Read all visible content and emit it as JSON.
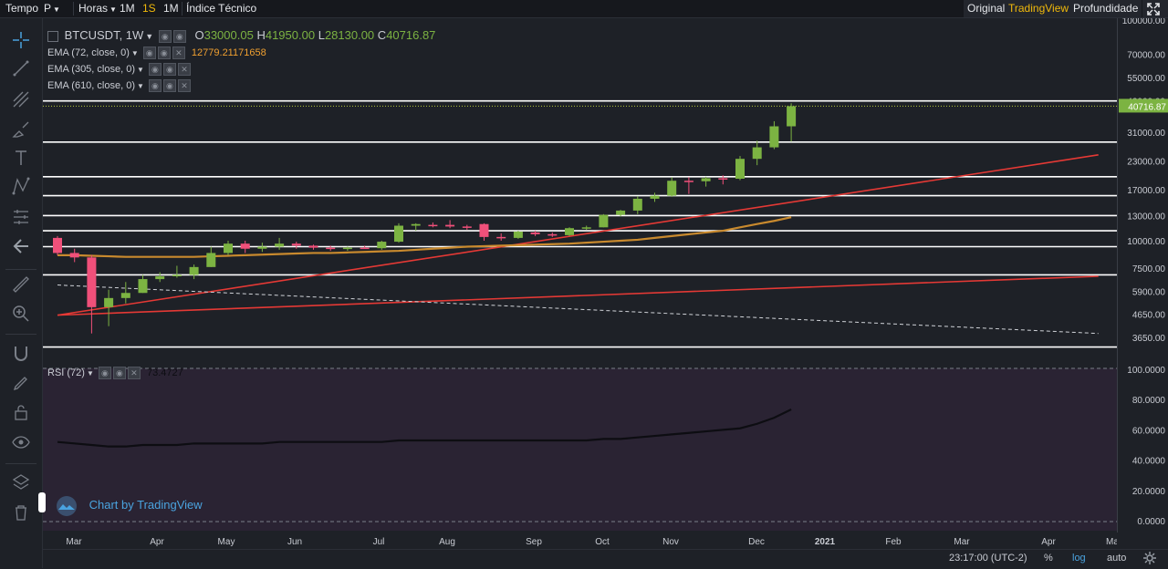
{
  "topbar": {
    "tempo": "Tempo",
    "p": "P",
    "horas": "Horas",
    "i1m_a": "1M",
    "i1s": "1S",
    "i1m_b": "1M",
    "indice": "Índice Técnico",
    "original": "Original",
    "tradingview": "TradingView",
    "profundidade": "Profundidade"
  },
  "legend": {
    "symbol": "BTCUSDT, 1W",
    "o_label": "O",
    "o_value": "33000.05",
    "h_label": "H",
    "h_value": "41950.00",
    "l_label": "L",
    "l_value": "28130.00",
    "c_label": "C",
    "c_value": "40716.87",
    "ema72": "EMA (72, close, 0)",
    "ema72_value": "12779.21171658",
    "ema305": "EMA (305, close, 0)",
    "ema610": "EMA (610, close, 0)",
    "rsi": "RSI (72)",
    "rsi_value": "73.4727"
  },
  "colors": {
    "up": "#7cb342",
    "down": "#f0507a",
    "ema": "#c98a2e",
    "trend": "#e53935",
    "accent": "#f0b90b",
    "rsi_bg": "#2a2333",
    "rsi_line": "#0d0d12"
  },
  "price_axis": {
    "labels": [
      "100000.00",
      "70000.00",
      "55000.00",
      "43000.00",
      "31000.00",
      "23000.00",
      "17000.00",
      "13000.00",
      "10000.00",
      "7500.00",
      "5900.00",
      "4650.00",
      "3650.00"
    ],
    "current": "40716.87"
  },
  "rsi_axis": {
    "labels": [
      "100.0000",
      "80.0000",
      "60.0000",
      "40.0000",
      "20.0000",
      "0.0000"
    ]
  },
  "time_axis": {
    "labels": [
      "Mar",
      "Apr",
      "May",
      "Jun",
      "Jul",
      "Aug",
      "Sep",
      "Oct",
      "Nov",
      "Dec",
      "2021",
      "Feb",
      "Mar",
      "Apr",
      "Ma"
    ]
  },
  "bottombar": {
    "time": "23:17:00 (UTC-2)",
    "percent": "%",
    "log": "log",
    "auto": "auto"
  },
  "badge": {
    "text": "Chart by TradingView"
  },
  "chart_data": {
    "type": "candlestick",
    "symbol": "BTCUSDT",
    "interval": "1W",
    "scale": "log",
    "candles": [
      {
        "o": 10300,
        "h": 10500,
        "l": 8600,
        "c": 8800
      },
      {
        "o": 8800,
        "h": 9200,
        "l": 8000,
        "c": 8400
      },
      {
        "o": 8400,
        "h": 8600,
        "l": 3800,
        "c": 5000
      },
      {
        "o": 5000,
        "h": 6000,
        "l": 4100,
        "c": 5500
      },
      {
        "o": 5500,
        "h": 6500,
        "l": 5200,
        "c": 5800
      },
      {
        "o": 5800,
        "h": 7000,
        "l": 5800,
        "c": 6700
      },
      {
        "o": 6700,
        "h": 7200,
        "l": 6500,
        "c": 6900
      },
      {
        "o": 6900,
        "h": 7700,
        "l": 6800,
        "c": 7000
      },
      {
        "o": 7000,
        "h": 7800,
        "l": 6700,
        "c": 7600
      },
      {
        "o": 7600,
        "h": 9400,
        "l": 7600,
        "c": 8800
      },
      {
        "o": 8800,
        "h": 10000,
        "l": 8600,
        "c": 9700
      },
      {
        "o": 9700,
        "h": 10000,
        "l": 8800,
        "c": 9200
      },
      {
        "o": 9200,
        "h": 9800,
        "l": 8900,
        "c": 9400
      },
      {
        "o": 9400,
        "h": 10300,
        "l": 9100,
        "c": 9700
      },
      {
        "o": 9700,
        "h": 9900,
        "l": 9200,
        "c": 9500
      },
      {
        "o": 9500,
        "h": 9600,
        "l": 9100,
        "c": 9300
      },
      {
        "o": 9300,
        "h": 9500,
        "l": 9000,
        "c": 9200
      },
      {
        "o": 9200,
        "h": 9400,
        "l": 9000,
        "c": 9300
      },
      {
        "o": 9300,
        "h": 9500,
        "l": 9200,
        "c": 9250
      },
      {
        "o": 9250,
        "h": 10000,
        "l": 9100,
        "c": 9900
      },
      {
        "o": 9900,
        "h": 12000,
        "l": 9800,
        "c": 11700
      },
      {
        "o": 11700,
        "h": 12000,
        "l": 11100,
        "c": 11900
      },
      {
        "o": 11800,
        "h": 12100,
        "l": 11500,
        "c": 11700
      },
      {
        "o": 11800,
        "h": 12400,
        "l": 11400,
        "c": 11600
      },
      {
        "o": 11600,
        "h": 11800,
        "l": 11200,
        "c": 11500
      },
      {
        "o": 11900,
        "h": 12000,
        "l": 10000,
        "c": 10400
      },
      {
        "o": 10400,
        "h": 10800,
        "l": 10000,
        "c": 10300
      },
      {
        "o": 10300,
        "h": 11100,
        "l": 10200,
        "c": 11000
      },
      {
        "o": 10900,
        "h": 11100,
        "l": 10500,
        "c": 10700
      },
      {
        "o": 10700,
        "h": 10900,
        "l": 10400,
        "c": 10600
      },
      {
        "o": 10600,
        "h": 11500,
        "l": 10500,
        "c": 11400
      },
      {
        "o": 11400,
        "h": 11700,
        "l": 11200,
        "c": 11500
      },
      {
        "o": 11500,
        "h": 13200,
        "l": 11500,
        "c": 13100
      },
      {
        "o": 13100,
        "h": 13800,
        "l": 12900,
        "c": 13700
      },
      {
        "o": 13700,
        "h": 15900,
        "l": 13200,
        "c": 15500
      },
      {
        "o": 15500,
        "h": 16500,
        "l": 15000,
        "c": 16000
      },
      {
        "o": 16000,
        "h": 19400,
        "l": 15800,
        "c": 18700
      },
      {
        "o": 18700,
        "h": 19400,
        "l": 16300,
        "c": 18600
      },
      {
        "o": 18600,
        "h": 19500,
        "l": 17600,
        "c": 19200
      },
      {
        "o": 19200,
        "h": 19800,
        "l": 18000,
        "c": 19100
      },
      {
        "o": 19100,
        "h": 24200,
        "l": 18800,
        "c": 23500
      },
      {
        "o": 23500,
        "h": 28400,
        "l": 22000,
        "c": 26500
      },
      {
        "o": 26500,
        "h": 34800,
        "l": 26000,
        "c": 33000
      },
      {
        "o": 33000,
        "h": 41950,
        "l": 28130,
        "c": 40716.87
      }
    ],
    "ema72": [
      8600,
      8600,
      8550,
      8500,
      8450,
      8450,
      8450,
      8450,
      8450,
      8500,
      8550,
      8600,
      8650,
      8700,
      8750,
      8800,
      8800,
      8850,
      8900,
      8950,
      9000,
      9100,
      9200,
      9300,
      9400,
      9450,
      9500,
      9550,
      9600,
      9650,
      9700,
      9800,
      9900,
      10000,
      10100,
      10300,
      10500,
      10700,
      10900,
      11100,
      11500,
      11900,
      12300,
      12779.21
    ],
    "horizontal_levels": [
      43000,
      28000,
      19500,
      16000,
      13000,
      11100,
      9400,
      7000,
      3300
    ],
    "trendlines": [
      {
        "from": {
          "i": 0,
          "v": 4600
        },
        "to": {
          "i": 61,
          "v": 24500
        }
      },
      {
        "from": {
          "i": 0,
          "v": 4600
        },
        "to": {
          "i": 61,
          "v": 6900
        }
      }
    ],
    "dashed_line": {
      "from": {
        "i": 0,
        "v": 6300
      },
      "to": {
        "i": 61,
        "v": 3800
      }
    },
    "rsi": [
      52,
      51,
      50,
      49,
      49,
      50,
      50,
      50,
      51,
      51,
      51,
      51,
      51,
      52,
      52,
      52,
      52,
      52,
      52,
      52,
      53,
      53,
      53,
      53,
      53,
      53,
      53,
      53,
      53,
      53,
      53,
      53,
      54,
      54,
      55,
      56,
      57,
      58,
      59,
      60,
      61,
      64,
      68,
      73.4727
    ],
    "rsi_range": [
      0,
      100
    ],
    "log_ticks": [
      100000,
      70000,
      55000,
      43000,
      31000,
      23000,
      17000,
      13000,
      10000,
      7500,
      5900,
      4650,
      3650
    ]
  }
}
